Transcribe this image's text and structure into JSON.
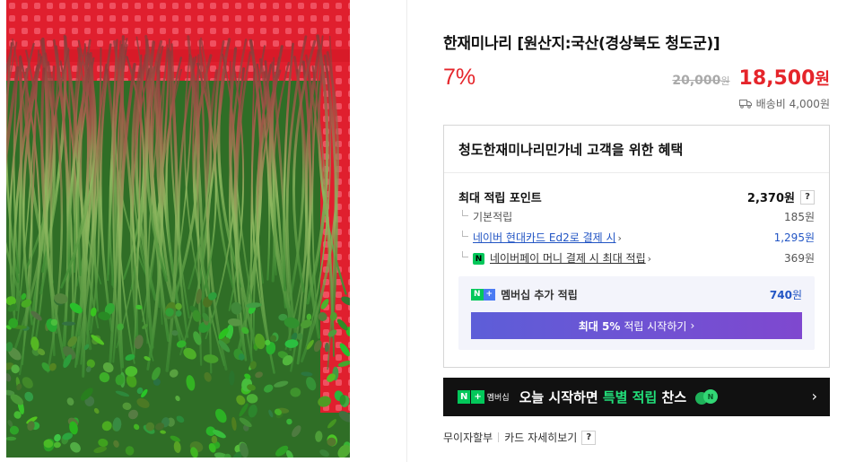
{
  "product": {
    "title": "한재미나리 [원산지:국산(경상북도 청도군)]",
    "discount": "7%",
    "original_price": "20,000",
    "original_unit": "원",
    "sale_price": "18,500",
    "sale_unit": "원",
    "shipping": "배송비 4,000원"
  },
  "benefits": {
    "title": "청도한재미나리민가네 고객을 위한 혜택",
    "max_points_label": "최대 적립 포인트",
    "max_points_value": "2,370원",
    "help_label": "?",
    "rows": [
      {
        "label": "기본적립",
        "value": "185원"
      },
      {
        "label": "네이버 현대카드 Ed2로 결제 시",
        "value": "1,295원"
      },
      {
        "label": "네이버페이 머니 결제 시 최대 적립",
        "value": "369원"
      }
    ],
    "npay_icon_text": "N",
    "membership": {
      "badge_n": "N",
      "badge_plus": "+",
      "label": "멤버십 추가 적립",
      "value": "740",
      "unit": "원",
      "button_bold": "최대 5%",
      "button_text": "적립 시작하기"
    }
  },
  "banner": {
    "badge_n": "N",
    "badge_plus": "+",
    "badge_text": "멤버십",
    "text_prefix": "오늘 시작하면 ",
    "text_highlight": "특별 적립",
    "text_suffix": " 찬스"
  },
  "links": {
    "installment": "무이자할부",
    "card_details": "카드 자세히보기",
    "help_label": "?"
  },
  "chevron": "›",
  "colors": {
    "price_red": "#e5252b",
    "link_blue": "#2255c4",
    "naver_green": "#03c75a",
    "banner_bg": "#111111"
  }
}
